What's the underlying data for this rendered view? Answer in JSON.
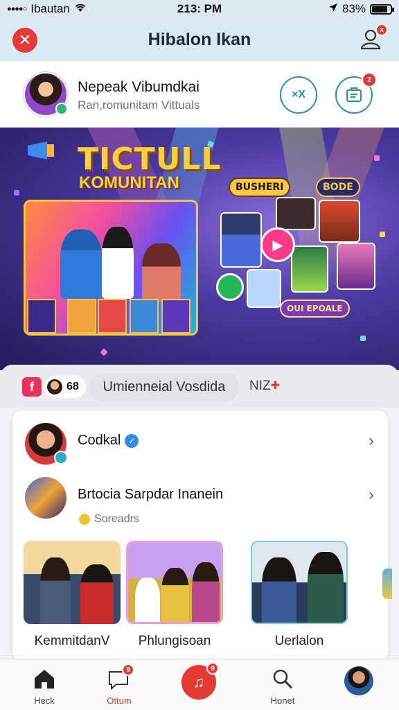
{
  "status_bar": {
    "carrier": "Ibautan",
    "time": "213: PM",
    "battery": "83%",
    "battery_level": 0.83
  },
  "header": {
    "title": "Hibalon Ikan",
    "profile_badge": "x"
  },
  "profile": {
    "name": "Nepeak Vibumdkai",
    "subtitle": "Ran,romunitam Vittuals",
    "action1_label": "×X",
    "notif_badge": "2"
  },
  "banner": {
    "title_line1": "TICTULL",
    "title_line2": "KOMUNITAN",
    "sticker1": "BUSHERI",
    "sticker2": "BODE",
    "sticker3": "OUI EPOALE"
  },
  "filter_row": {
    "fb_glyph": "f",
    "count": "68",
    "pill_text": "Umienneial Vosdida",
    "right_text": "NIZ"
  },
  "list": {
    "row1_title": "Codkal",
    "row2_title": "Brtocia Sarpdar Inanein",
    "row2_sub": "Soreadrs"
  },
  "photos": [
    {
      "label": "KemmitdanV"
    },
    {
      "label": "Phlungisoan"
    },
    {
      "label": "Uerlalon"
    }
  ],
  "nav": {
    "home": "Heck",
    "chat": "Ottum",
    "chat_badge": "9",
    "center_badge": "9",
    "search": "Honet"
  },
  "colors": {
    "accent": "#e53935",
    "teal": "#2d8fa4",
    "header_bg": "#d9e9ef"
  }
}
